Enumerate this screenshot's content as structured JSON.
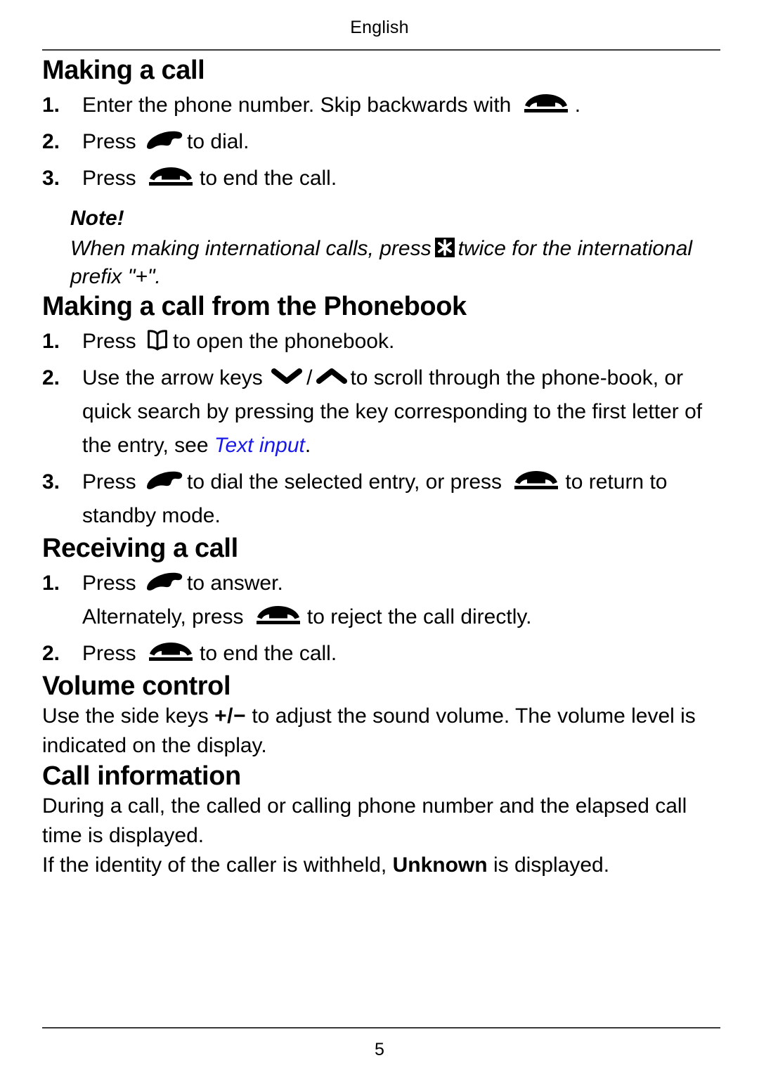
{
  "header": {
    "language": "English"
  },
  "footer": {
    "page_number": "5"
  },
  "sections": {
    "making_call": {
      "title": "Making a call",
      "steps": [
        {
          "num": "1.",
          "text_before": "Enter the phone number. Skip backwards with",
          "icon": "handset-on-hook-icon",
          "text_after": "."
        },
        {
          "num": "2.",
          "text_before": "Press",
          "icon": "handset-off-hook-icon",
          "text_after": "to dial."
        },
        {
          "num": "3.",
          "text_before": "Press",
          "icon": "handset-on-hook-icon",
          "text_after": "to end the call."
        }
      ],
      "note": {
        "title": "Note!",
        "text_before": "When making international calls, press",
        "icon": "star-key-icon",
        "text_after": "twice for the international prefix \"+\"."
      }
    },
    "phonebook": {
      "title": "Making a call from the Phonebook",
      "steps": [
        {
          "num": "1.",
          "text_before": "Press",
          "icon": "phonebook-icon",
          "text_after": "to open the phonebook."
        },
        {
          "num": "2.",
          "text_before": "Use the arrow keys",
          "icon_down": "chevron-down-icon",
          "separator": "/",
          "icon_up": "chevron-up-icon",
          "text_after": "to scroll through the phone-book, or quick search by pressing the key corresponding to the first letter of the entry, see",
          "link": "Text input",
          "text_end": "."
        },
        {
          "num": "3.",
          "text_before": "Press",
          "icon_a": "handset-off-hook-icon",
          "text_mid": "to dial the selected entry, or press",
          "icon_b": "handset-on-hook-icon",
          "text_after": "to return to standby mode."
        }
      ]
    },
    "receiving": {
      "title": "Receiving a call",
      "steps": [
        {
          "num": "1.",
          "text_before": "Press",
          "icon": "handset-off-hook-icon",
          "text_after": "to answer.",
          "sub_before": "Alternately, press",
          "sub_icon": "handset-on-hook-icon",
          "sub_after": "to reject the call directly."
        },
        {
          "num": "2.",
          "text_before": "Press",
          "icon": "handset-on-hook-icon",
          "text_after": "to end the call."
        }
      ]
    },
    "volume": {
      "title": "Volume control",
      "text_before": "Use the side keys",
      "keys": "+/−",
      "text_after": "to adjust the sound volume. The volume level is indicated on the display."
    },
    "call_information": {
      "title": "Call information",
      "paragraph_1": "During a call, the called or calling phone number and the elapsed call time is displayed.",
      "paragraph_2_before": "If the identity of the caller is withheld,",
      "paragraph_2_bold": "Unknown",
      "paragraph_2_after": "is displayed."
    }
  },
  "colors": {
    "link": "#1a19e8",
    "text": "#000000",
    "rule": "#3a3a3a"
  }
}
